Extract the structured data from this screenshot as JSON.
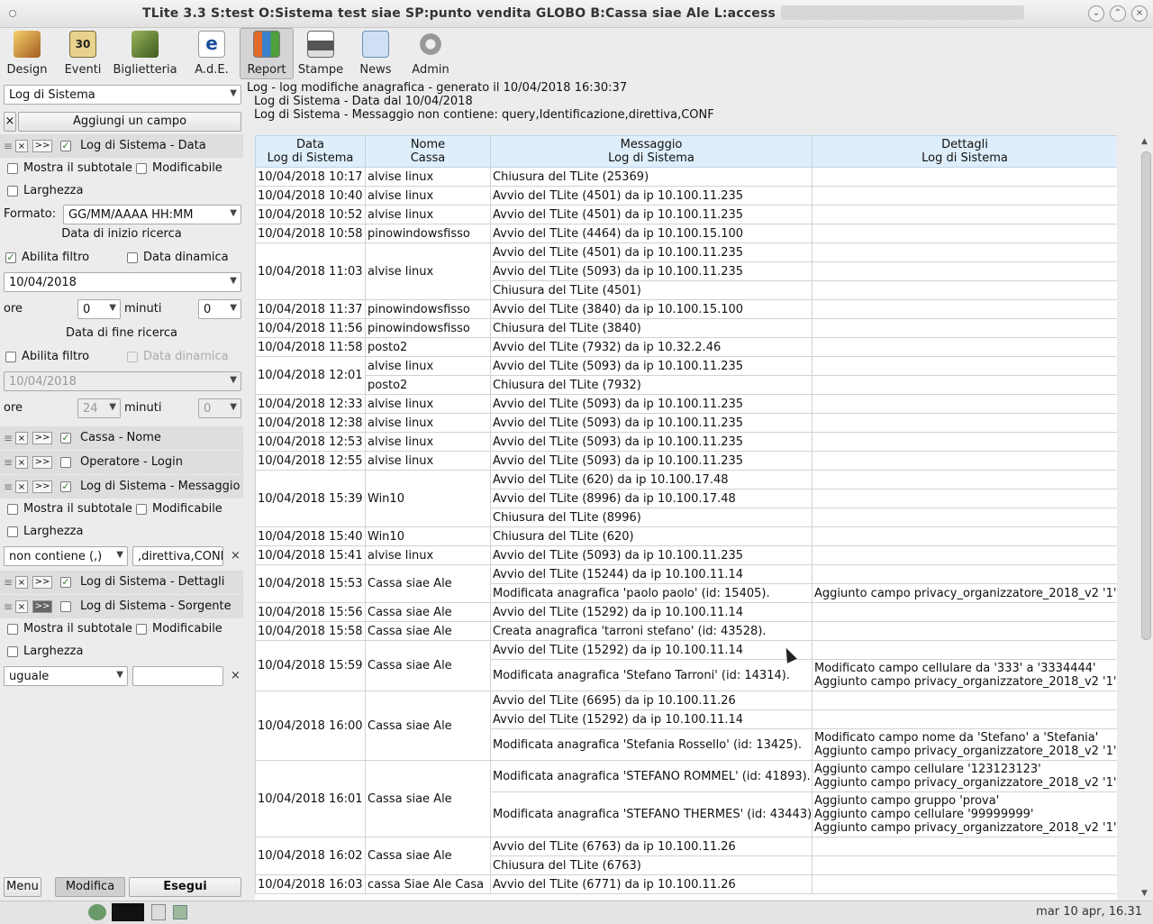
{
  "window": {
    "title": "TLite 3.3 S:test O:Sistema test siae SP:punto vendita GLOBO B:Cassa siae Ale L:access",
    "buttons": [
      "chevron-down",
      "chevron-up",
      "close"
    ]
  },
  "toolbar": [
    {
      "label": "Design",
      "icon": "design-icon"
    },
    {
      "label": "Eventi",
      "icon": "calendar-icon"
    },
    {
      "label": "Biglietteria",
      "icon": "ticket-icon"
    },
    {
      "label": "A.d.E.",
      "icon": "ade-icon"
    },
    {
      "label": "Report",
      "icon": "report-icon",
      "active": true
    },
    {
      "label": "Stampe",
      "icon": "printer-icon"
    },
    {
      "label": "News",
      "icon": "mail-icon"
    },
    {
      "label": "Admin",
      "icon": "gears-icon"
    }
  ],
  "left": {
    "source_select": "Log di Sistema",
    "add_field_button": "Aggiungi un campo",
    "field_data": {
      "label": "Log di Sistema - Data",
      "checked": true
    },
    "subtotal": "Mostra il subtotale",
    "editable": "Modificabile",
    "width": "Larghezza",
    "format_label": "Formato:",
    "format_value": "GG/MM/AAAA HH:MM",
    "start_title": "Data di inizio ricerca",
    "enable_filter": "Abilita filtro",
    "dynamic_date": "Data dinamica",
    "start_date": "10/04/2018",
    "hours_label": "ore",
    "start_hours": "0",
    "minutes_label": "minuti",
    "start_minutes": "0",
    "end_title": "Data di fine ricerca",
    "end_date": "10/04/2018",
    "end_hours": "24",
    "end_minutes": "0",
    "field_cassa": "Cassa - Nome",
    "field_operatore": "Operatore - Login",
    "field_messaggio": "Log di Sistema - Messaggio",
    "msg_operator": "non contiene (,)",
    "msg_value": ",direttiva,CONF",
    "field_dettagli": "Log di Sistema - Dettagli",
    "field_sorgente": "Log di Sistema - Sorgente",
    "src_operator": "uguale",
    "menu_button": "Menu",
    "modify_button": "Modifica",
    "run_button": "Esegui"
  },
  "report": {
    "line1": "Log - log modifiche anagrafica - generato il 10/04/2018 16:30:37",
    "line2": "Log di Sistema - Data dal 10/04/2018",
    "line3": "Log di Sistema - Messaggio non contiene: query,Identificazione,direttiva,CONF",
    "headers": [
      [
        "Data",
        "Log di Sistema"
      ],
      [
        "Nome",
        "Cassa"
      ],
      [
        "Messaggio",
        "Log di Sistema"
      ],
      [
        "Dettagli",
        "Log di Sistema"
      ]
    ]
  },
  "rows": [
    {
      "date": "10/04/2018 10:17",
      "cassa": "alvise linux",
      "msgs": [
        {
          "m": "Chiusura del TLite (25369)",
          "d": []
        }
      ]
    },
    {
      "date": "10/04/2018 10:40",
      "cassa": "alvise linux",
      "msgs": [
        {
          "m": "Avvio del TLite (4501) da ip 10.100.11.235",
          "d": []
        }
      ]
    },
    {
      "date": "10/04/2018 10:52",
      "cassa": "alvise linux",
      "msgs": [
        {
          "m": "Avvio del TLite (4501) da ip 10.100.11.235",
          "d": []
        }
      ]
    },
    {
      "date": "10/04/2018 10:58",
      "cassa": "pinowindowsfisso",
      "msgs": [
        {
          "m": "Avvio del TLite (4464) da ip 10.100.15.100",
          "d": []
        }
      ]
    },
    {
      "date": "10/04/2018 11:03",
      "cassa": "alvise linux",
      "msgs": [
        {
          "m": "Avvio del TLite (4501) da ip 10.100.11.235",
          "d": []
        },
        {
          "m": "Avvio del TLite (5093) da ip 10.100.11.235",
          "d": []
        },
        {
          "m": "Chiusura del TLite (4501)",
          "d": []
        }
      ]
    },
    {
      "date": "10/04/2018 11:37",
      "cassa": "pinowindowsfisso",
      "msgs": [
        {
          "m": "Avvio del TLite (3840) da ip 10.100.15.100",
          "d": []
        }
      ]
    },
    {
      "date": "10/04/2018 11:56",
      "cassa": "pinowindowsfisso",
      "msgs": [
        {
          "m": "Chiusura del TLite (3840)",
          "d": []
        }
      ]
    },
    {
      "date": "10/04/2018 11:58",
      "cassa": "posto2",
      "msgs": [
        {
          "m": "Avvio del TLite (7932) da ip 10.32.2.46",
          "d": []
        }
      ]
    },
    {
      "date": "10/04/2018 12:01",
      "cassa": "",
      "cassa_split": [
        "alvise linux",
        "posto2"
      ],
      "msgs": [
        {
          "m": "Avvio del TLite (5093) da ip 10.100.11.235",
          "d": []
        },
        {
          "m": "Chiusura del TLite (7932)",
          "d": []
        }
      ]
    },
    {
      "date": "10/04/2018 12:33",
      "cassa": "alvise linux",
      "msgs": [
        {
          "m": "Avvio del TLite (5093) da ip 10.100.11.235",
          "d": []
        }
      ]
    },
    {
      "date": "10/04/2018 12:38",
      "cassa": "alvise linux",
      "msgs": [
        {
          "m": "Avvio del TLite (5093) da ip 10.100.11.235",
          "d": []
        }
      ]
    },
    {
      "date": "10/04/2018 12:53",
      "cassa": "alvise linux",
      "msgs": [
        {
          "m": "Avvio del TLite (5093) da ip 10.100.11.235",
          "d": []
        }
      ]
    },
    {
      "date": "10/04/2018 12:55",
      "cassa": "alvise linux",
      "msgs": [
        {
          "m": "Avvio del TLite (5093) da ip 10.100.11.235",
          "d": []
        }
      ]
    },
    {
      "date": "10/04/2018 15:39",
      "cassa": "Win10",
      "msgs": [
        {
          "m": "Avvio del TLite (620) da ip 10.100.17.48",
          "d": []
        },
        {
          "m": "Avvio del TLite (8996) da ip 10.100.17.48",
          "d": []
        },
        {
          "m": "Chiusura del TLite (8996)",
          "d": []
        }
      ]
    },
    {
      "date": "10/04/2018 15:40",
      "cassa": "Win10",
      "msgs": [
        {
          "m": "Chiusura del TLite (620)",
          "d": []
        }
      ]
    },
    {
      "date": "10/04/2018 15:41",
      "cassa": "alvise linux",
      "msgs": [
        {
          "m": "Avvio del TLite (5093) da ip 10.100.11.235",
          "d": []
        }
      ]
    },
    {
      "date": "10/04/2018 15:53",
      "cassa": "Cassa siae Ale",
      "msgs": [
        {
          "m": "Avvio del TLite (15244) da ip 10.100.11.14",
          "d": []
        },
        {
          "m": "Modificata anagrafica 'paolo paolo' (id: 15405).",
          "d": [
            "Aggiunto campo privacy_organizzatore_2018_v2 '1'"
          ]
        }
      ]
    },
    {
      "date": "10/04/2018 15:56",
      "cassa": "Cassa siae Ale",
      "msgs": [
        {
          "m": "Avvio del TLite (15292) da ip 10.100.11.14",
          "d": []
        }
      ]
    },
    {
      "date": "10/04/2018 15:58",
      "cassa": "Cassa siae Ale",
      "msgs": [
        {
          "m": "Creata anagrafica 'tarroni stefano' (id: 43528).",
          "d": []
        }
      ]
    },
    {
      "date": "10/04/2018 15:59",
      "cassa": "Cassa siae Ale",
      "msgs": [
        {
          "m": "Avvio del TLite (15292) da ip 10.100.11.14",
          "d": []
        },
        {
          "m": "Modificata anagrafica 'Stefano Tarroni' (id: 14314).",
          "d": [
            "Modificato campo cellulare da '333' a '3334444'",
            "Aggiunto campo privacy_organizzatore_2018_v2 '1'"
          ]
        }
      ]
    },
    {
      "date": "10/04/2018 16:00",
      "cassa": "Cassa siae Ale",
      "msgs": [
        {
          "m": "Avvio del TLite (6695) da ip 10.100.11.26",
          "d": []
        },
        {
          "m": "Avvio del TLite (15292) da ip 10.100.11.14",
          "d": []
        },
        {
          "m": "Modificata anagrafica 'Stefania Rossello' (id: 13425).",
          "d": [
            "Modificato campo nome da 'Stefano' a 'Stefania'",
            "Aggiunto campo privacy_organizzatore_2018_v2 '1'"
          ]
        }
      ]
    },
    {
      "date": "10/04/2018 16:01",
      "cassa": "Cassa siae Ale",
      "msgs": [
        {
          "m": "Modificata anagrafica 'STEFANO ROMMEL' (id: 41893).",
          "d": [
            "Aggiunto campo cellulare '123123123'",
            "Aggiunto campo privacy_organizzatore_2018_v2 '1'"
          ]
        },
        {
          "m": "Modificata anagrafica 'STEFANO THERMES' (id: 43443).",
          "d": [
            "Aggiunto campo gruppo 'prova'",
            "Aggiunto campo cellulare '99999999'",
            "Aggiunto campo privacy_organizzatore_2018_v2 '1'"
          ]
        }
      ]
    },
    {
      "date": "10/04/2018 16:02",
      "cassa": "Cassa siae Ale",
      "msgs": [
        {
          "m": "Avvio del TLite (6763) da ip 10.100.11.26",
          "d": []
        },
        {
          "m": "Chiusura del TLite (6763)",
          "d": []
        }
      ]
    },
    {
      "date": "10/04/2018 16:03",
      "cassa": "cassa Siae Ale Casa",
      "msgs": [
        {
          "m": "Avvio del TLite (6771) da ip 10.100.11.26",
          "d": []
        }
      ]
    }
  ],
  "status": {
    "clock": "mar 10 apr, 16.31"
  },
  "colors": {
    "header_bg": "#dfeefb",
    "active_tab": "#d4d4d4"
  }
}
